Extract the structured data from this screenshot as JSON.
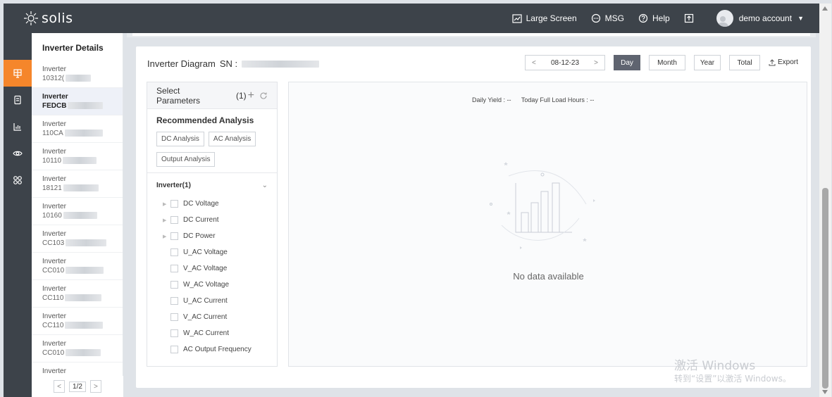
{
  "brand": {
    "name": "solis"
  },
  "topbar": {
    "large_screen": "Large Screen",
    "msg": "MSG",
    "help": "Help",
    "account": "demo account"
  },
  "rail": {
    "items": [
      "plant-icon",
      "device-icon",
      "report-icon",
      "monitor-icon",
      "apps-icon"
    ]
  },
  "inverter_list": {
    "title": "Inverter Details",
    "items": [
      {
        "label": "Inverter",
        "sn": "10312("
      },
      {
        "label": "Inverter",
        "sn": "FEDCB"
      },
      {
        "label": "Inverter",
        "sn": "110CA"
      },
      {
        "label": "Inverter",
        "sn": "10110"
      },
      {
        "label": "Inverter",
        "sn": "18121"
      },
      {
        "label": "Inverter",
        "sn": "10160"
      },
      {
        "label": "Inverter",
        "sn": "CC103"
      },
      {
        "label": "Inverter",
        "sn": "CC010"
      },
      {
        "label": "Inverter",
        "sn": "CC110"
      },
      {
        "label": "Inverter",
        "sn": "CC110"
      },
      {
        "label": "Inverter",
        "sn": "CC010"
      },
      {
        "label": "Inverter",
        "sn": ""
      }
    ],
    "page": "1/2"
  },
  "diagram": {
    "title": "Inverter Diagram",
    "sn_label": "SN :",
    "date": "08-12-23",
    "periods": [
      "Day",
      "Month",
      "Year",
      "Total"
    ],
    "active_period": "Day",
    "export": "Export"
  },
  "params": {
    "title": "Select Parameters",
    "count": "(1)",
    "recommended_title": "Recommended Analysis",
    "analyses": [
      "DC Analysis",
      "AC Analysis",
      "Output Analysis"
    ],
    "group": "Inverter(1)",
    "items": [
      {
        "label": "DC Voltage",
        "expandable": true
      },
      {
        "label": "DC Current",
        "expandable": true
      },
      {
        "label": "DC Power",
        "expandable": true
      },
      {
        "label": "U_AC Voltage",
        "expandable": false
      },
      {
        "label": "V_AC Voltage",
        "expandable": false
      },
      {
        "label": "W_AC Voltage",
        "expandable": false
      },
      {
        "label": "U_AC Current",
        "expandable": false
      },
      {
        "label": "V_AC Current",
        "expandable": false
      },
      {
        "label": "W_AC Current",
        "expandable": false
      },
      {
        "label": "AC Output Frequency",
        "expandable": false
      }
    ]
  },
  "chart": {
    "daily_yield": "Daily Yield : --",
    "full_load": "Today Full Load Hours : --",
    "empty": "No data available"
  },
  "watermark": {
    "line1": "激活 Windows",
    "line2": "转到“设置”以激活 Windows。"
  },
  "colors": {
    "topbar": "#3d434a",
    "accent": "#f5862b",
    "active_segment": "#5f6470"
  }
}
